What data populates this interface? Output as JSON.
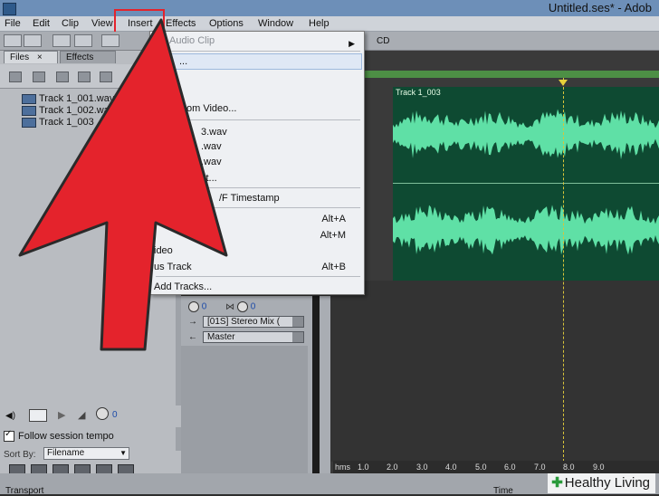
{
  "window": {
    "title": "Untitled.ses* - Adob"
  },
  "menubar": {
    "items": [
      "File",
      "Edit",
      "Clip",
      "View",
      "Insert",
      "Effects",
      "Options",
      "Window",
      "Help"
    ]
  },
  "toolbar": {
    "cd_label": "CD"
  },
  "files_panel": {
    "tabs": [
      "Files",
      "Effects"
    ],
    "files": [
      "Track 1_001.wav",
      "Track 1_002.wav",
      "Track 1_003"
    ],
    "follow_session_tempo": "Follow session tempo",
    "sort_by_label": "Sort By:",
    "sort_by_value": "Filename"
  },
  "insert_menu": {
    "items": [
      {
        "label": "ty Audio Clip",
        "shortcut": "",
        "disabled": true,
        "submenu": true
      },
      {
        "label": "...",
        "shortcut": "",
        "disabled": false
      },
      {
        "label": "",
        "shortcut": "",
        "disabled": false
      },
      {
        "label": "om Video...",
        "shortcut": "",
        "disabled": false
      },
      {
        "label": "3.wav",
        "shortcut": "",
        "disabled": false
      },
      {
        "label": ".wav",
        "shortcut": "",
        "disabled": false
      },
      {
        "label": ".wav",
        "shortcut": "",
        "disabled": false
      },
      {
        "label": "st...",
        "shortcut": "",
        "disabled": false
      },
      {
        "label": "/F Timestamp",
        "shortcut": "",
        "disabled": false
      },
      {
        "label": "",
        "shortcut": "Alt+A",
        "disabled": false
      },
      {
        "label": "",
        "shortcut": "Alt+M",
        "disabled": false
      },
      {
        "label": "ideo",
        "shortcut": "",
        "disabled": false
      },
      {
        "label": "us Track",
        "shortcut": "Alt+B",
        "disabled": false
      },
      {
        "label": "Add Tracks...",
        "shortcut": "",
        "disabled": false
      }
    ]
  },
  "mixer": {
    "volume_value": "0",
    "pan_value": "0",
    "output_select": "[01S] Stereo Mix (",
    "bus_select": "Master"
  },
  "transport_mini": {
    "value": "0"
  },
  "track": {
    "clip_label": "Track 1_003"
  },
  "timeline": {
    "ticks": [
      "hms",
      "1.0",
      "2.0",
      "3.0",
      "4.0",
      "5.0",
      "6.0",
      "7.0",
      "8.0",
      "9.0"
    ]
  },
  "bottom_tabs": {
    "transport": "Transport",
    "time": "Time"
  },
  "watermark": {
    "text": "Healthy Living"
  },
  "colors": {
    "annotation_red": "#e4232c",
    "waveform": "#5fe0a6",
    "track_bg": "#0e4a32"
  }
}
